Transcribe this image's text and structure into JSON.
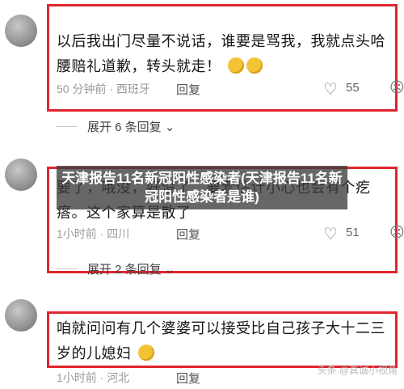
{
  "overlay": {
    "title": "天津报告11名新冠阳性感染者(天津报告11名新冠阳性感染者是谁)"
  },
  "comments": [
    {
      "text": "以后我出门尽量不说话，谁要是骂我，我就点头哈腰赔礼道歉，转头就走！",
      "time_location": "50 分钟前 · 西班牙",
      "reply_label": "回复",
      "likes": "55",
      "expand_label": "展开 6 条回复"
    },
    {
      "text": "要了，哦没，好没了，要套估计小心也会有个疙瘩。这个家算是散了",
      "time_location": "1小时前 · 四川",
      "reply_label": "回复",
      "likes": "51",
      "expand_label": "展开 2 条回复"
    },
    {
      "text": "咱就问问有几个婆婆可以接受比自己孩子大十二三岁的儿媳妇",
      "time_location": "1小时前 · 河北",
      "reply_label": "回复"
    }
  ],
  "watermark": "头条 @真诚小视角",
  "icons": {
    "heart": "heart-outline-icon",
    "dislike": "dislike-icon",
    "chevron": "chevron-down-icon"
  },
  "colors": {
    "highlight_border": "#e0252e",
    "overlay_bg": "#3c3c3c"
  }
}
